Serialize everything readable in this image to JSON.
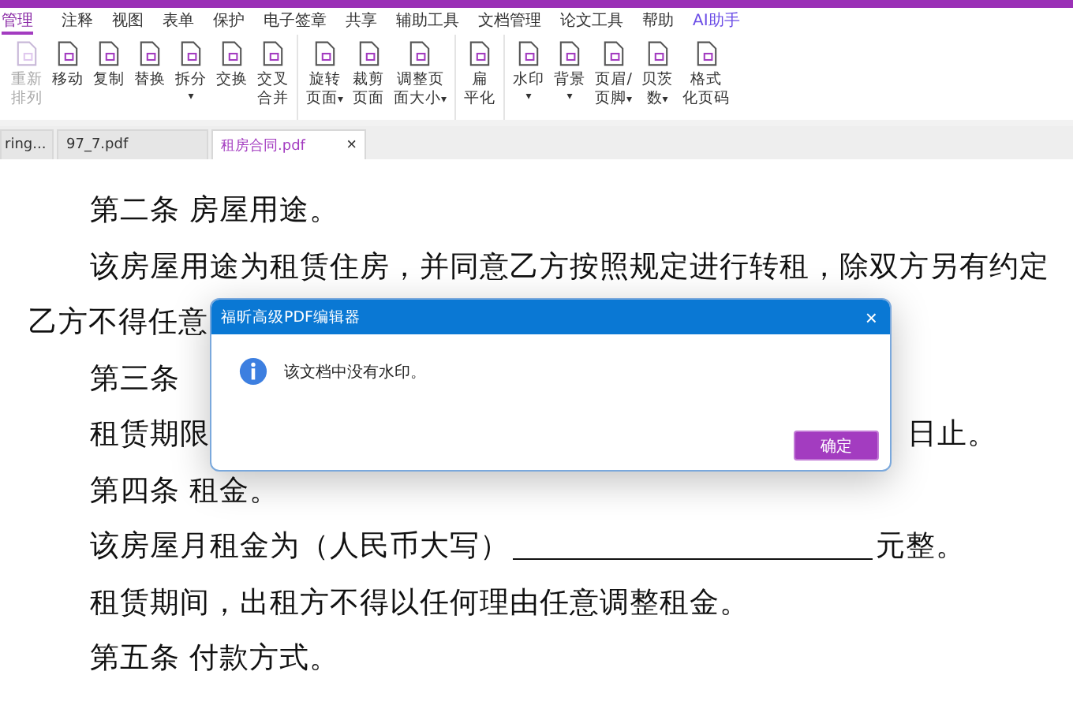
{
  "menu": [
    {
      "label": "管理",
      "selected": true
    },
    {
      "label": "注释",
      "selected": false
    },
    {
      "label": "视图",
      "selected": false
    },
    {
      "label": "表单",
      "selected": false
    },
    {
      "label": "保护",
      "selected": false
    },
    {
      "label": "电子签章",
      "selected": false
    },
    {
      "label": "共享",
      "selected": false
    },
    {
      "label": "辅助工具",
      "selected": false
    },
    {
      "label": "文档管理",
      "selected": false
    },
    {
      "label": "论文工具",
      "selected": false
    },
    {
      "label": "帮助",
      "selected": false
    },
    {
      "label": "AI助手",
      "selected": false,
      "kind": "ai"
    }
  ],
  "toolbar": [
    [
      {
        "lines": [
          "重新",
          "排列"
        ],
        "disabled": true
      },
      {
        "lines": [
          "移动"
        ],
        "disabled": false
      },
      {
        "lines": [
          "复制"
        ],
        "disabled": false
      },
      {
        "lines": [
          "替换"
        ],
        "disabled": false
      },
      {
        "lines": [
          "拆分"
        ],
        "disabled": false,
        "caret": "▾"
      },
      {
        "lines": [
          "交换"
        ],
        "disabled": false
      },
      {
        "lines": [
          "交叉",
          "合并"
        ],
        "disabled": false
      }
    ],
    [
      {
        "lines": [
          "旋转",
          "页面"
        ],
        "disabled": false,
        "caret": "▾"
      },
      {
        "lines": [
          "裁剪",
          "页面"
        ],
        "disabled": false
      },
      {
        "lines": [
          "调整页",
          "面大小"
        ],
        "disabled": false,
        "caret": "▾"
      }
    ],
    [
      {
        "lines": [
          "扁",
          "平化"
        ],
        "disabled": false
      }
    ],
    [
      {
        "lines": [
          "水印"
        ],
        "disabled": false,
        "caret": "▾"
      },
      {
        "lines": [
          "背景"
        ],
        "disabled": false,
        "caret": "▾"
      },
      {
        "lines": [
          "页眉/",
          "页脚"
        ],
        "disabled": false,
        "caret": "▾"
      },
      {
        "lines": [
          "贝茨",
          "数"
        ],
        "disabled": false,
        "caret": "▾"
      },
      {
        "lines": [
          "格式",
          "化页码"
        ],
        "disabled": false
      }
    ]
  ],
  "doc_tabs": [
    {
      "label": "ring...",
      "selected": false
    },
    {
      "label": "97_7.pdf",
      "selected": false
    },
    {
      "label": "租房合同.pdf",
      "selected": true,
      "close": "×"
    }
  ],
  "document": [
    {
      "kind": "heading",
      "text": "第二条  房屋用途。"
    },
    {
      "kind": "para",
      "text": "该房屋用途为租赁住房，并同意乙方按照规定进行转租，除双方另有约定"
    },
    {
      "kind": "cont",
      "text": "乙方不得任意"
    },
    {
      "kind": "heading",
      "text": "第三条"
    },
    {
      "kind": "split",
      "text": "租赁期限",
      "end": "日止。"
    },
    {
      "kind": "heading",
      "text": "第四条  租金。"
    },
    {
      "kind": "blank",
      "text": "该房屋月租金为（人民币大写）",
      "end": "元整。"
    },
    {
      "kind": "para",
      "text": "租赁期间，出租方不得以任何理由任意调整租金。"
    },
    {
      "kind": "heading",
      "text": "第五条  付款方式。"
    }
  ],
  "dialog": {
    "title": "福昕高级PDF编辑器",
    "close": "×",
    "message": "该文档中没有水印。",
    "buttons": [
      "确定"
    ]
  }
}
